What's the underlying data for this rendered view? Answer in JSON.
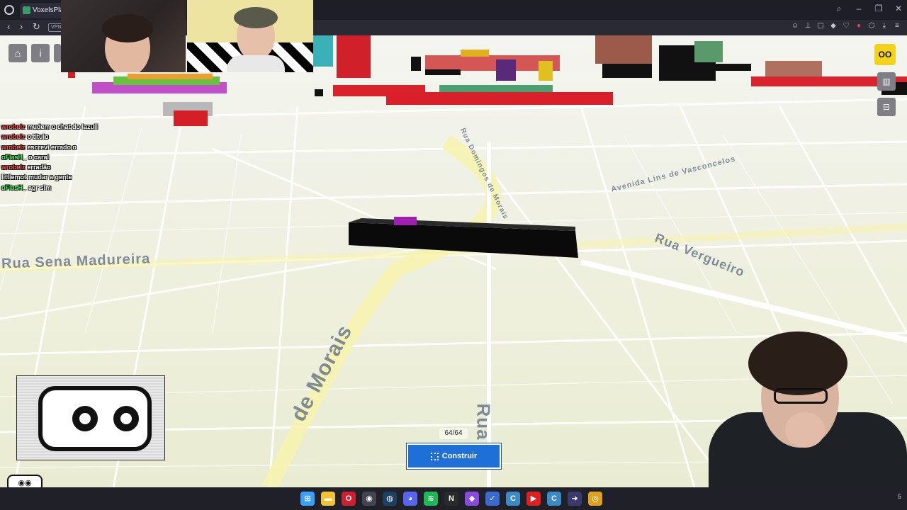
{
  "browser": {
    "tab_title": "VoxelsPlac",
    "vpn_label": "VPN",
    "nav": {
      "back": "‹",
      "forward": "›",
      "reload": "↻"
    },
    "window_controls": [
      "search-icon",
      "minimize-icon",
      "restore-icon",
      "close-icon"
    ],
    "extensions": [
      "emoji-icon",
      "pin-icon",
      "snapshot-icon",
      "wallet-icon",
      "heart-icon",
      "record-icon",
      "extensions-icon",
      "download-icon",
      "menu-icon"
    ]
  },
  "map": {
    "streets": [
      {
        "name": "Rua Sena Madureira"
      },
      {
        "name": "Rua Domingos de Morais"
      },
      {
        "name": "Rua Vergueiro"
      },
      {
        "name": "Avenida Lins de Vasconcelos"
      },
      {
        "name": "de Morais"
      },
      {
        "name": "Rua"
      }
    ]
  },
  "toolbar": {
    "home_icon": "home-icon",
    "info_icon": "info-icon",
    "logo_text": "OO",
    "stats_icon": "bar-chart-icon",
    "cart_icon": "cart-icon"
  },
  "chat": [
    {
      "user": "wrobelz",
      "user_color": "#ff5050",
      "message": "mudem o chat do lazuli"
    },
    {
      "user": "wrobelz",
      "user_color": "#ff5050",
      "message": "o titulo"
    },
    {
      "user": "wrobelz",
      "user_color": "#ff5050",
      "message": "escrevi errado o"
    },
    {
      "user": "oFlasH_",
      "user_color": "#33ff55",
      "message": "o caral"
    },
    {
      "user": "wrobelz",
      "user_color": "#ff5050",
      "message": "erradão"
    },
    {
      "user": "littlemot",
      "user_color": "#ffffff",
      "message": "mudar a gente"
    },
    {
      "user": "oFlasH_",
      "user_color": "#33ff55",
      "message": "agr sim"
    }
  ],
  "build": {
    "counter": "64/64",
    "button_label": "Construir"
  },
  "taskbar": {
    "icons": [
      {
        "name": "windows-start-icon",
        "color": "#3aa0ff",
        "glyph": "⊞"
      },
      {
        "name": "file-explorer-icon",
        "color": "#f2c230",
        "glyph": "▬"
      },
      {
        "name": "opera-icon",
        "color": "#d02030",
        "glyph": "O"
      },
      {
        "name": "obs-icon",
        "color": "#444450",
        "glyph": "◉"
      },
      {
        "name": "steam-icon",
        "color": "#1b4060",
        "glyph": "◍"
      },
      {
        "name": "discord-icon",
        "color": "#5865f2",
        "glyph": "◕"
      },
      {
        "name": "spotify-icon",
        "color": "#1db954",
        "glyph": "≋"
      },
      {
        "name": "notion-icon",
        "color": "#2a2a2a",
        "glyph": "N"
      },
      {
        "name": "app-purple-icon",
        "color": "#8a4ae0",
        "glyph": "◆"
      },
      {
        "name": "tasks-icon",
        "color": "#3a6ad0",
        "glyph": "✓"
      },
      {
        "name": "app-c-icon",
        "color": "#3a8ac8",
        "glyph": "C"
      },
      {
        "name": "youtube-icon",
        "color": "#e02020",
        "glyph": "▶"
      },
      {
        "name": "app-c2-icon",
        "color": "#3a8ac8",
        "glyph": "C"
      },
      {
        "name": "app-arrow-icon",
        "color": "#3a3a70",
        "glyph": "➜"
      },
      {
        "name": "chrome-icon",
        "color": "#e0a020",
        "glyph": "◎"
      }
    ],
    "tray_text": "5"
  }
}
